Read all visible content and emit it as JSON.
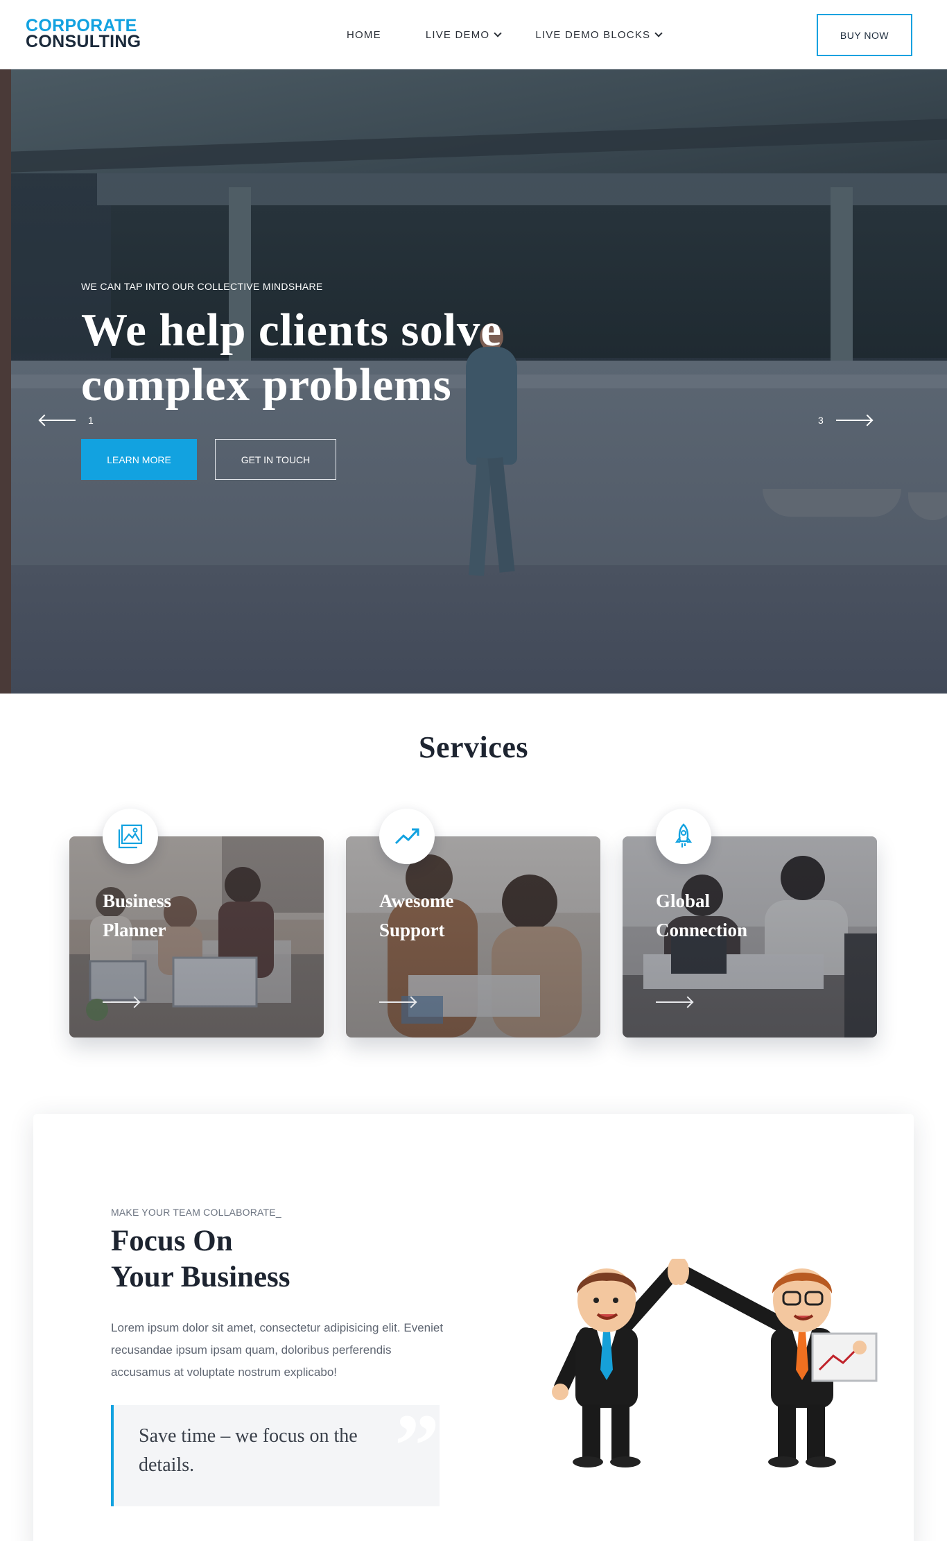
{
  "header": {
    "logo_line1": "CORPORATE",
    "logo_line2": "CONSULTING",
    "nav": [
      {
        "label": "HOME"
      },
      {
        "label": "LIVE DEMO"
      },
      {
        "label": "LIVE DEMO BLOCKS"
      }
    ],
    "buy_label": "BUY NOW"
  },
  "hero": {
    "kicker": "WE CAN TAP INTO OUR COLLECTIVE MINDSHARE",
    "title_line1": "We help clients solve",
    "title_line2": "complex problems",
    "learn_more": "LEARN MORE",
    "get_in_touch": "GET IN TOUCH",
    "prev_index": "1",
    "next_index": "3"
  },
  "services": {
    "title": "Services",
    "cards": [
      {
        "line1": "Business",
        "line2": "Planner",
        "icon": "image-gallery-icon"
      },
      {
        "line1": "Awesome",
        "line2": "Support",
        "icon": "trending-up-icon"
      },
      {
        "line1": "Global",
        "line2": "Connection",
        "icon": "rocket-icon"
      }
    ]
  },
  "focus": {
    "kicker": "MAKE YOUR TEAM COLLABORATE_",
    "title_line1": "Focus On",
    "title_line2": "Your Business",
    "body": "Lorem ipsum dolor sit amet, consectetur adipisicing elit. Eveniet recusandae ipsum ipsam quam, doloribus perferendis accusamus at voluptate nostrum explicabo!",
    "quote": "Save time – we focus on the details.",
    "quote_mark": "”"
  },
  "colors": {
    "accent": "#12a2e0",
    "dark": "#1b2a3b"
  }
}
